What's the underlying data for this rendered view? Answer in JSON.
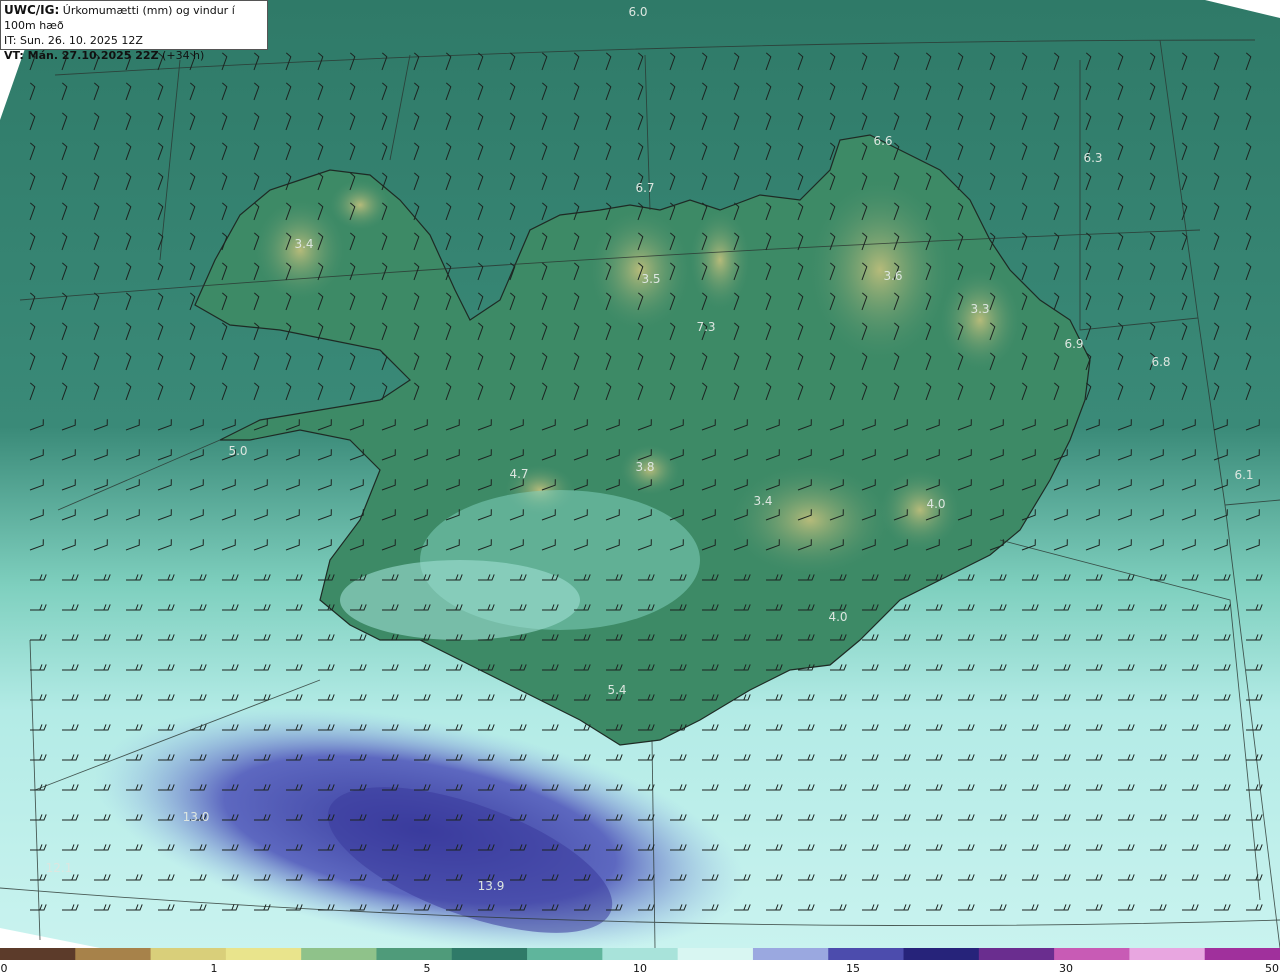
{
  "info_box": {
    "title_bold": "UWC/IG:",
    "title_rest": " Úrkomumætti (mm) og vindur í 100m hæð",
    "it_line": "IT: Sun. 26. 10. 2025 12Z",
    "vt_bold": "VT: Mán. 27.10.2025 22Z",
    "vt_rest": " (+34 h)"
  },
  "map_labels": [
    {
      "text": "6.0"
    },
    {
      "text": "6.6"
    },
    {
      "text": "6.3"
    },
    {
      "text": "6.7"
    },
    {
      "text": "3.4"
    },
    {
      "text": "3.5"
    },
    {
      "text": "3.6"
    },
    {
      "text": "3.3"
    },
    {
      "text": "7.3"
    },
    {
      "text": "6.9"
    },
    {
      "text": "6.8"
    },
    {
      "text": "5.0"
    },
    {
      "text": "4.7"
    },
    {
      "text": "3.8"
    },
    {
      "text": "3.4"
    },
    {
      "text": "4.0"
    },
    {
      "text": "6.1"
    },
    {
      "text": "4.0"
    },
    {
      "text": "5.4"
    },
    {
      "text": "13.0"
    },
    {
      "text": "12.1"
    },
    {
      "text": "13.9"
    }
  ],
  "colorbar": {
    "ticks": [
      "0",
      "1",
      "5",
      "10",
      "15",
      "30",
      "50"
    ],
    "colors": [
      "#5c3b2a",
      "#a7824a",
      "#d9cf7a",
      "#e9e48c",
      "#8fc28a",
      "#4f9b7a",
      "#2f7a68",
      "#5fb59c",
      "#a8e3da",
      "#d8f6f2",
      "#9aa8e0",
      "#4c4cad",
      "#26237a",
      "#6a2d8f",
      "#c85bb5",
      "#e8a6e0",
      "#a0309c"
    ]
  },
  "colors": {
    "sea_low": "#2f7a68",
    "sea_mid": "#6fc2ad",
    "sea_high": "#b6ecea",
    "heavy": "#4b4fb0",
    "land": "#3f8a66",
    "highland": "#a7b777"
  }
}
